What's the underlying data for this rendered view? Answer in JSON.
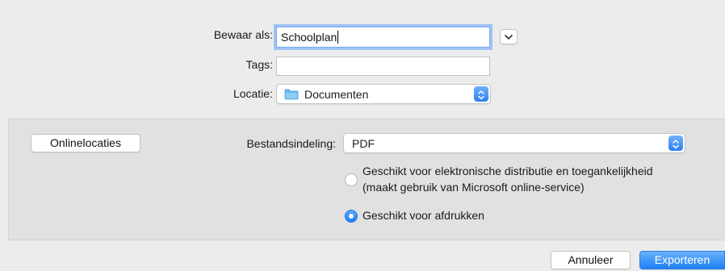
{
  "save_dialog": {
    "save_as_label": "Bewaar als:",
    "save_as_value": "Schoolplan",
    "tags_label": "Tags:",
    "tags_value": "",
    "location_label": "Locatie:",
    "location_value": "Documenten",
    "location_icon": "folder-icon"
  },
  "options": {
    "online_locations_label": "Onlinelocaties",
    "format_label": "Bestandsindeling:",
    "format_value": "PDF",
    "radio_options": [
      {
        "line1": "Geschikt voor elektronische distributie en toegankelijkheid",
        "line2": "(maakt gebruik van Microsoft online-service)",
        "selected": false
      },
      {
        "line1": "Geschikt voor afdrukken",
        "selected": true
      }
    ]
  },
  "footer": {
    "cancel_label": "Annuleer",
    "export_label": "Exporteren"
  },
  "colors": {
    "accent": "#1e7ef5",
    "focus_ring": "#9fc3f6",
    "panel": "#e1e1e1",
    "background": "#ececec"
  }
}
